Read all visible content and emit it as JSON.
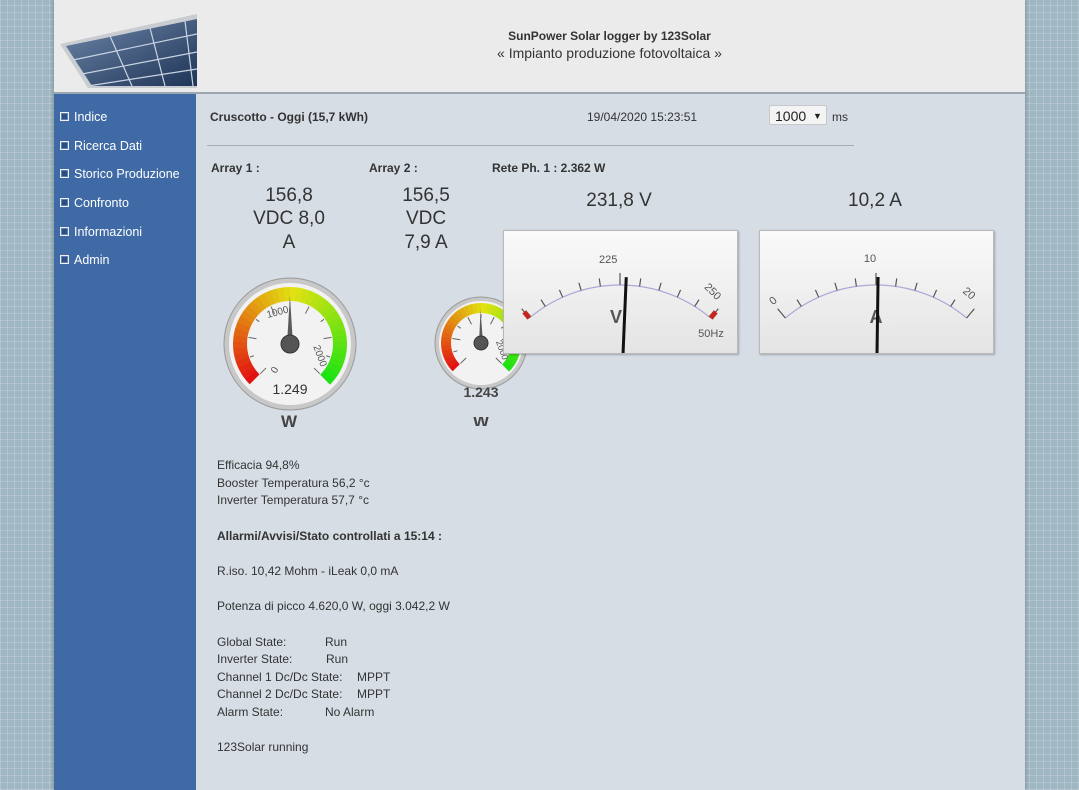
{
  "header": {
    "title": "SunPower Solar logger by 123Solar",
    "subtitle": "« Impianto produzione fotovoltaica »"
  },
  "sidebar": {
    "items": [
      {
        "label": "Indice"
      },
      {
        "label": "Ricerca Dati"
      },
      {
        "label": "Storico Produzione"
      },
      {
        "label": "Confronto"
      },
      {
        "label": "Informazioni"
      },
      {
        "label": "Admin"
      }
    ]
  },
  "dashboard": {
    "title": "Cruscotto - Oggi (15,7 kWh)",
    "datetime": "19/04/2020 15:23:51",
    "refresh": {
      "value": "1000",
      "unit": "ms"
    }
  },
  "array1": {
    "label": "Array 1 :",
    "lines": [
      "156,8",
      "VDC 8,0",
      "A"
    ],
    "gauge": {
      "value": 1.249,
      "display": "1.249",
      "unit": "W",
      "ticks": [
        "0",
        "1000",
        "2000"
      ],
      "max": 2500
    }
  },
  "array2": {
    "label": "Array 2 :",
    "lines": [
      "156,5",
      "VDC",
      "7,9 A"
    ],
    "gauge": {
      "value": 1.243,
      "display": "1.243",
      "unit": "W",
      "ticks": [
        "2000"
      ],
      "max": 2500
    }
  },
  "grid": {
    "label": "Rete Ph. 1 : 2.362 W",
    "voltage": {
      "display": "231,8 V",
      "value": 231.8,
      "min": 200,
      "max": 260,
      "ticks": [
        "225",
        "250"
      ],
      "unit": "V",
      "freq": "50Hz"
    },
    "current": {
      "display": "10,2 A",
      "value": 10.2,
      "min": 0,
      "max": 20,
      "ticks": [
        "0",
        "10",
        "20"
      ],
      "unit": "A"
    }
  },
  "info": {
    "efficiency": "Efficacia 94,8%",
    "booster_temp": "Booster Temperatura 56,2 °c",
    "inverter_temp": "Inverter Temperatura 57,7 °c",
    "alarms_title": "Allarmi/Avvisi/Stato controllati a 15:14 :",
    "riso": "R.iso. 10,42 Mohm - iLeak 0,0 mA",
    "peak_power": "Potenza di picco 4.620,0 W, oggi 3.042,2 W",
    "states": [
      {
        "label": "Global State:",
        "value": "Run"
      },
      {
        "label": "Inverter State:",
        "value": "Run"
      },
      {
        "label": "Channel 1 Dc/Dc State:",
        "value": "MPPT"
      },
      {
        "label": "Channel 2 Dc/Dc State:",
        "value": "MPPT"
      },
      {
        "label": "Alarm State:",
        "value": "No Alarm"
      }
    ],
    "footer": "123Solar running"
  }
}
